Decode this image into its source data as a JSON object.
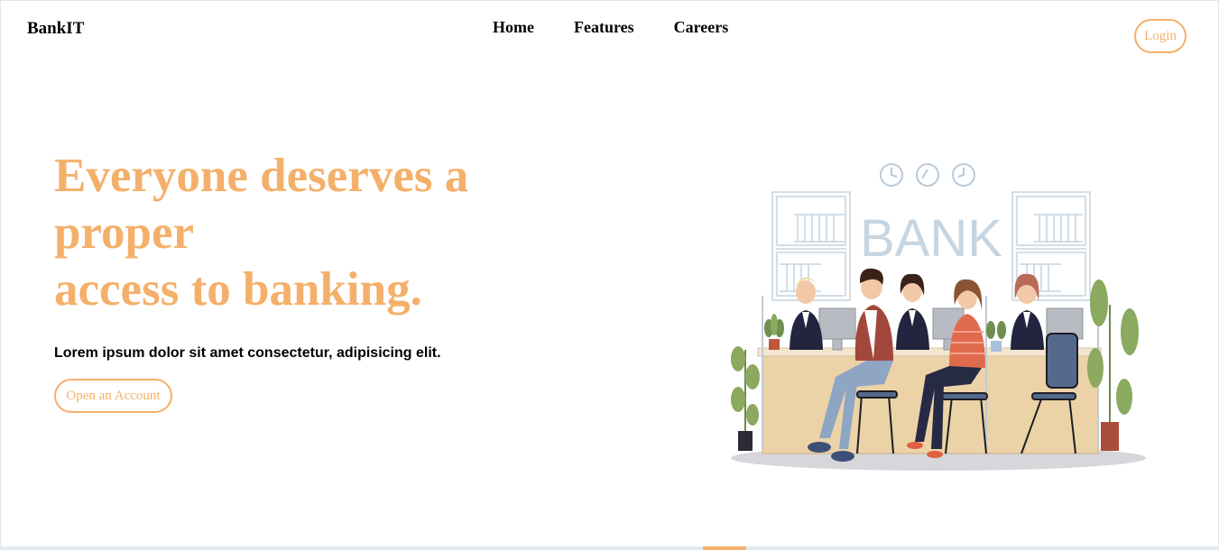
{
  "brand": "BankIT",
  "nav": [
    {
      "label": "Home"
    },
    {
      "label": "Features"
    },
    {
      "label": "Careers"
    }
  ],
  "login_label": "Login",
  "hero": {
    "title_line1": "Everyone deserves a",
    "title_line2": "proper",
    "title_line3": "access to banking.",
    "subtitle": "Lorem ipsum dolor sit amet consectetur, adipisicing elit.",
    "cta_label": "Open an Account"
  },
  "illustration": {
    "sign": "BANK"
  },
  "colors": {
    "accent": "#f4b06a",
    "text": "#000000",
    "background": "#ffffff"
  }
}
